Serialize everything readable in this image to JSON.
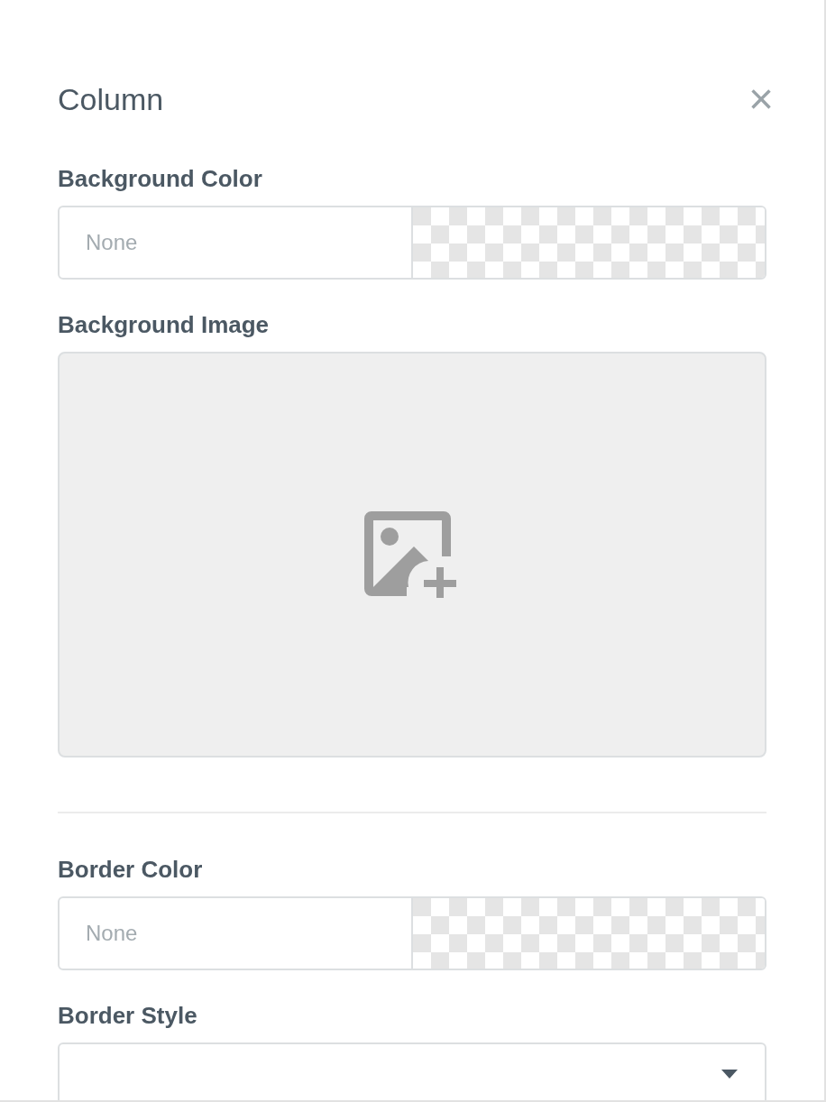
{
  "panel": {
    "title": "Column",
    "close": "×"
  },
  "sections": [
    {
      "kind": "color",
      "label": "Background Color",
      "placeholder": "None"
    },
    {
      "kind": "image",
      "label": "Background Image"
    },
    {
      "kind": "divider"
    },
    {
      "kind": "color",
      "label": "Border Color",
      "placeholder": "None"
    },
    {
      "kind": "select",
      "label": "Border Style"
    }
  ]
}
